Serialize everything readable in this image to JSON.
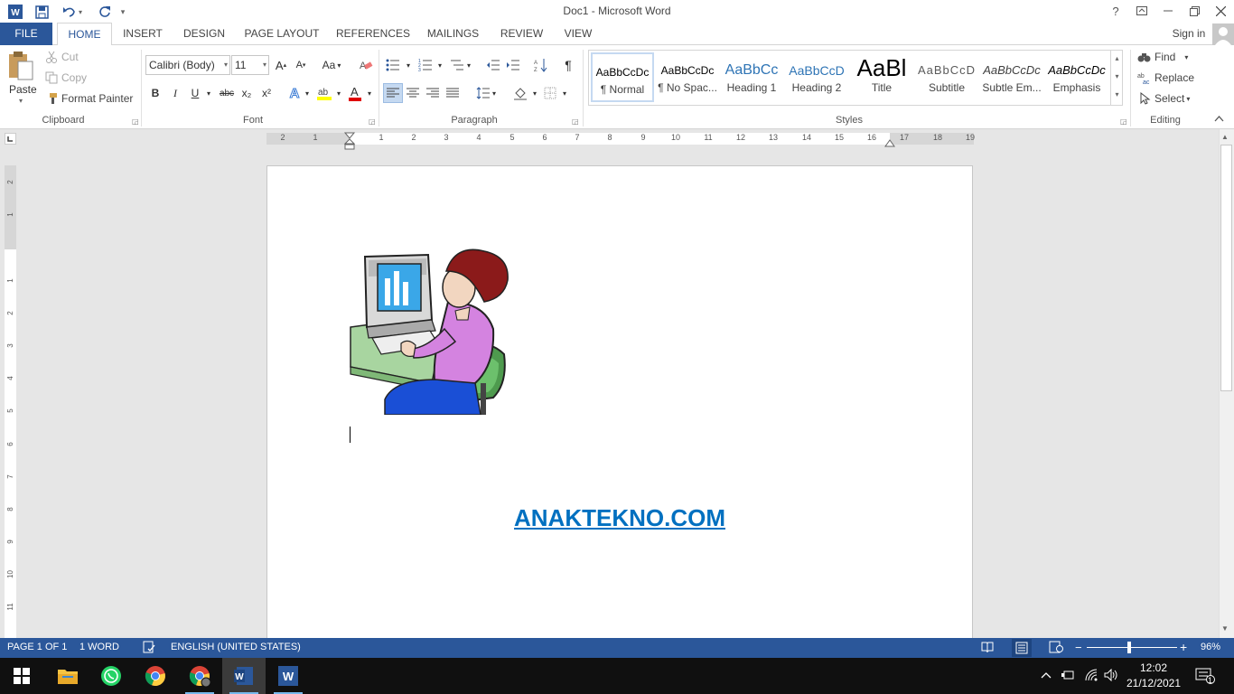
{
  "window": {
    "title": "Doc1 - Microsoft Word"
  },
  "qat": {
    "customize": "▾"
  },
  "titlebar_buttons": {
    "help": "?"
  },
  "tabs": [
    "FILE",
    "HOME",
    "INSERT",
    "DESIGN",
    "PAGE LAYOUT",
    "REFERENCES",
    "MAILINGS",
    "REVIEW",
    "VIEW"
  ],
  "account": {
    "sign_in": "Sign in"
  },
  "clipboard": {
    "paste": "Paste",
    "cut": "Cut",
    "copy": "Copy",
    "format_painter": "Format Painter",
    "label": "Clipboard"
  },
  "font": {
    "name": "Calibri (Body)",
    "size": "11",
    "change_case": "Aa",
    "label": "Font",
    "bold": "B",
    "italic": "I",
    "underline": "U",
    "strike": "abc",
    "subscript": "x₂",
    "superscript": "x²"
  },
  "paragraph": {
    "label": "Paragraph",
    "pilcrow": "¶"
  },
  "styles": {
    "label": "Styles",
    "items": [
      {
        "sample": "AaBbCcDc",
        "name": "¶ Normal"
      },
      {
        "sample": "AaBbCcDc",
        "name": "¶ No Spac..."
      },
      {
        "sample": "AaBbCc",
        "name": "Heading 1"
      },
      {
        "sample": "AaBbCcD",
        "name": "Heading 2"
      },
      {
        "sample": "AaBl",
        "name": "Title"
      },
      {
        "sample": "AaBbCcD",
        "name": "Subtitle"
      },
      {
        "sample": "AaBbCcDc",
        "name": "Subtle Em..."
      },
      {
        "sample": "AaBbCcDc",
        "name": "Emphasis"
      }
    ]
  },
  "editing": {
    "find": "Find",
    "replace": "Replace",
    "select": "Select",
    "label": "Editing"
  },
  "ruler": {
    "horizontal": [
      "2",
      "1",
      "1",
      "2",
      "3",
      "4",
      "5",
      "6",
      "7",
      "8",
      "9",
      "10",
      "11",
      "12",
      "13",
      "14",
      "15",
      "16",
      "17",
      "18",
      "19"
    ],
    "vertical": [
      "2",
      "1",
      "1",
      "2",
      "3",
      "4",
      "5",
      "6",
      "7",
      "8",
      "9",
      "10",
      "11"
    ]
  },
  "document": {
    "link_text": "ANAKTEKNO.COM"
  },
  "statusbar": {
    "page": "PAGE 1 OF 1",
    "words": "1 WORD",
    "language": "ENGLISH (UNITED STATES)",
    "zoom": "96%",
    "zoom_minus": "−",
    "zoom_plus": "+"
  },
  "taskbar": {
    "time": "12:02",
    "date": "21/12/2021",
    "notifications": "1"
  },
  "colors": {
    "accent": "#2b579a",
    "link": "#0070c0",
    "taskbar": "#101010"
  }
}
